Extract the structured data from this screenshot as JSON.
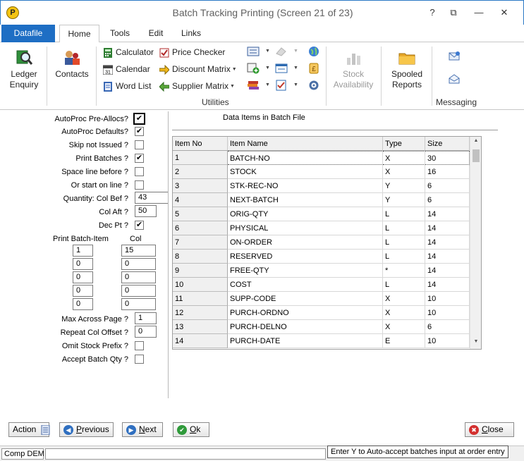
{
  "window": {
    "title": "Batch Tracking Printing  (Screen 21 of 23)",
    "logo_letter": "P",
    "help_glyph": "?",
    "restore_glyph": "⧉",
    "minimize_glyph": "—",
    "close_glyph": "✕"
  },
  "ribbon": {
    "tabs": [
      "Datafile",
      "Home",
      "Tools",
      "Edit",
      "Links"
    ],
    "active_tab": "Home",
    "ledger_enquiry_line1": "Ledger",
    "ledger_enquiry_line2": "Enquiry",
    "contacts": "Contacts",
    "calculator": "Calculator",
    "calendar": "Calendar",
    "word_list": "Word List",
    "price_checker": "Price Checker",
    "discount_matrix": "Discount Matrix",
    "supplier_matrix": "Supplier Matrix",
    "utilities_label": "Utilities",
    "stock_availability_line1": "Stock",
    "stock_availability_line2": "Availability",
    "spooled_reports_line1": "Spooled",
    "spooled_reports_line2": "Reports",
    "messaging_label": "Messaging",
    "calendar_icon_text": "31",
    "dropdown_arrow": "▼"
  },
  "form": {
    "autoproc_preallocs": {
      "label": "AutoProc Pre-Allocs?",
      "checked": true
    },
    "autoproc_defaults": {
      "label": "AutoProc Defaults?",
      "checked": true
    },
    "skip_not_issued": {
      "label": "Skip not Issued ?",
      "checked": false
    },
    "print_batches": {
      "label": "Print Batches ?",
      "checked": true
    },
    "space_line_before": {
      "label": "Space line before ?",
      "checked": false
    },
    "start_on_line": {
      "label": "Or start on line ?",
      "checked": false
    },
    "quantity_col_bef": {
      "label": "Quantity: Col Bef ?",
      "value": "43"
    },
    "col_aft": {
      "label": "Col Aft ?",
      "value": "50"
    },
    "dec_pt": {
      "label": "Dec Pt ?",
      "checked": true
    },
    "print_batch_item_header": "Print Batch-Item",
    "col_header": "Col",
    "batch_items": [
      {
        "item": "1",
        "col": "15"
      },
      {
        "item": "0",
        "col": "0"
      },
      {
        "item": "0",
        "col": "0"
      },
      {
        "item": "0",
        "col": "0"
      },
      {
        "item": "0",
        "col": "0"
      }
    ],
    "max_across_page": {
      "label": "Max Across Page ?",
      "value": "1"
    },
    "repeat_col_offset": {
      "label": "Repeat Col Offset ?",
      "value": "0"
    },
    "omit_stock_prefix": {
      "label": "Omit Stock Prefix ?",
      "checked": false
    },
    "accept_batch_qty": {
      "label": "Accept Batch Qty ?",
      "checked": false
    },
    "check_glyph": "✔"
  },
  "data_items": {
    "title": "Data Items in Batch File",
    "columns": [
      "Item No",
      "Item Name",
      "Type",
      "Size"
    ],
    "rows": [
      [
        "1",
        "BATCH-NO",
        "X",
        "30"
      ],
      [
        "2",
        "STOCK",
        "X",
        "16"
      ],
      [
        "3",
        "STK-REC-NO",
        "Y",
        "6"
      ],
      [
        "4",
        "NEXT-BATCH",
        "Y",
        "6"
      ],
      [
        "5",
        "ORIG-QTY",
        "L",
        "14"
      ],
      [
        "6",
        "PHYSICAL",
        "L",
        "14"
      ],
      [
        "7",
        "ON-ORDER",
        "L",
        "14"
      ],
      [
        "8",
        "RESERVED",
        "L",
        "14"
      ],
      [
        "9",
        "FREE-QTY",
        "*",
        "14"
      ],
      [
        "10",
        "COST",
        "L",
        "14"
      ],
      [
        "11",
        "SUPP-CODE",
        "X",
        "10"
      ],
      [
        "12",
        "PURCH-ORDNO",
        "X",
        "10"
      ],
      [
        "13",
        "PURCH-DELNO",
        "X",
        "6"
      ],
      [
        "14",
        "PURCH-DATE",
        "E",
        "10"
      ]
    ],
    "scroll_up": "▲",
    "scroll_down": "▼"
  },
  "buttons": {
    "action": "Action",
    "previous": "Previous",
    "next": "Next",
    "ok": "Ok",
    "close": "Close",
    "previous_glyph": "◀",
    "next_glyph": "▶",
    "ok_glyph": "✔",
    "close_glyph": "✖"
  },
  "status": {
    "company": "Comp DEM",
    "hint": "Enter Y to Auto-accept batches input at order entry"
  }
}
